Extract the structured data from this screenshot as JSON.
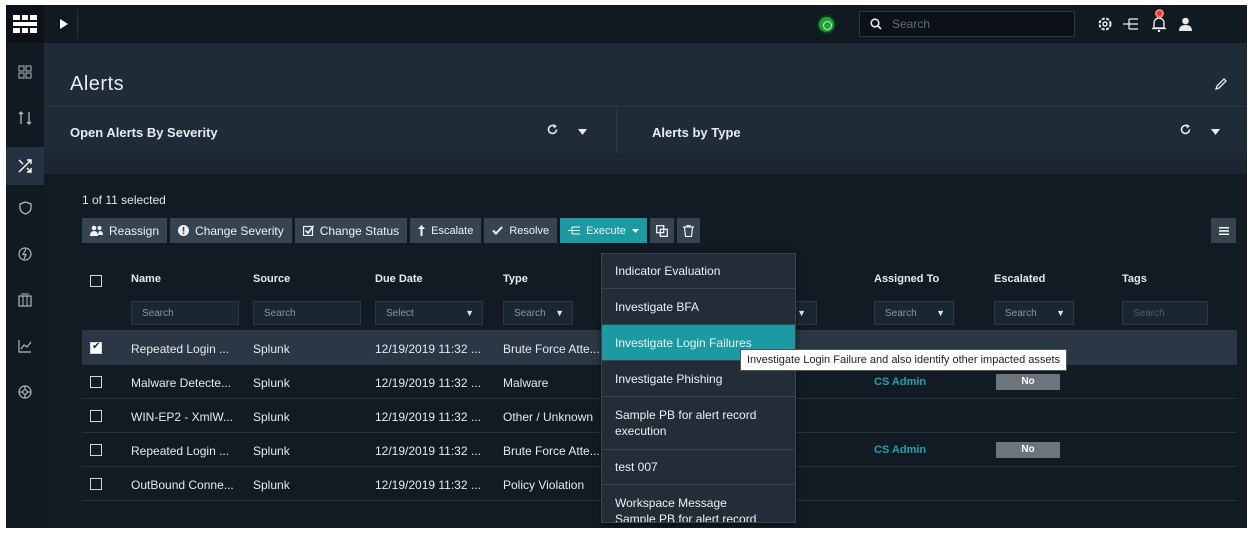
{
  "topbar": {
    "search_placeholder": "Search"
  },
  "sidebar": {
    "items": [
      {
        "icon": "dashboard-icon"
      },
      {
        "icon": "queue-icon"
      },
      {
        "icon": "incidents-icon",
        "active": true
      },
      {
        "icon": "shield-icon"
      },
      {
        "icon": "automation-icon"
      },
      {
        "icon": "resources-icon"
      },
      {
        "icon": "reports-icon"
      },
      {
        "icon": "settings-wheel-icon"
      }
    ]
  },
  "page": {
    "title": "Alerts"
  },
  "widgets": {
    "left_title": "Open Alerts By Severity",
    "right_title": "Alerts by Type"
  },
  "grid": {
    "selection_text": "1 of 11 selected",
    "toolbar": {
      "reassign": "Reassign",
      "change_severity": "Change Severity",
      "change_status": "Change Status",
      "escalate": "Escalate",
      "resolve": "Resolve",
      "execute": "Execute"
    },
    "columns": {
      "name": "Name",
      "source": "Source",
      "due_date": "Due Date",
      "type": "Type",
      "assigned_to": "Assigned To",
      "escalated": "Escalated",
      "tags": "Tags"
    },
    "filters": {
      "name": "Search",
      "source": "Search",
      "due_date": "Select",
      "type": "Search",
      "assigned_to": "Search",
      "escalated": "Search",
      "tags": "Search"
    },
    "rows": [
      {
        "checked": true,
        "name": "Repeated Login ...",
        "source": "Splunk",
        "due": "12/19/2019 11:32 ...",
        "type": "Brute Force Atte...",
        "assigned": "",
        "escalated": ""
      },
      {
        "checked": false,
        "name": "Malware Detecte...",
        "source": "Splunk",
        "due": "12/19/2019 11:32 ...",
        "type": "Malware",
        "assigned": "CS Admin",
        "escalated": "No"
      },
      {
        "checked": false,
        "name": "WIN-EP2 - XmlW...",
        "source": "Splunk",
        "due": "12/19/2019 11:32 ...",
        "type": "Other / Unknown",
        "assigned": "",
        "escalated": ""
      },
      {
        "checked": false,
        "name": "Repeated Login ...",
        "source": "Splunk",
        "due": "12/19/2019 11:32 ...",
        "type": "Brute Force Atte...",
        "assigned": "CS Admin",
        "escalated": "No"
      },
      {
        "checked": false,
        "name": "OutBound Conne...",
        "source": "Splunk",
        "due": "12/19/2019 11:32 ...",
        "type": "Policy Violation",
        "assigned": "",
        "escalated": ""
      }
    ]
  },
  "execute_menu": {
    "items": [
      "Indicator Evaluation",
      "Investigate BFA",
      "Investigate Login Failures",
      "Investigate Phishing",
      "Sample PB for alert record execution",
      "test 007",
      "Workspace Message",
      "Sample PB for alert record"
    ],
    "highlighted": "Investigate Login Failures",
    "tooltip": "Investigate Login Failure and also identify other impacted assets"
  },
  "colors": {
    "accent": "#1c9aa2",
    "background": "#1b2630",
    "panel": "#121b24",
    "link": "#1ca3ad"
  }
}
